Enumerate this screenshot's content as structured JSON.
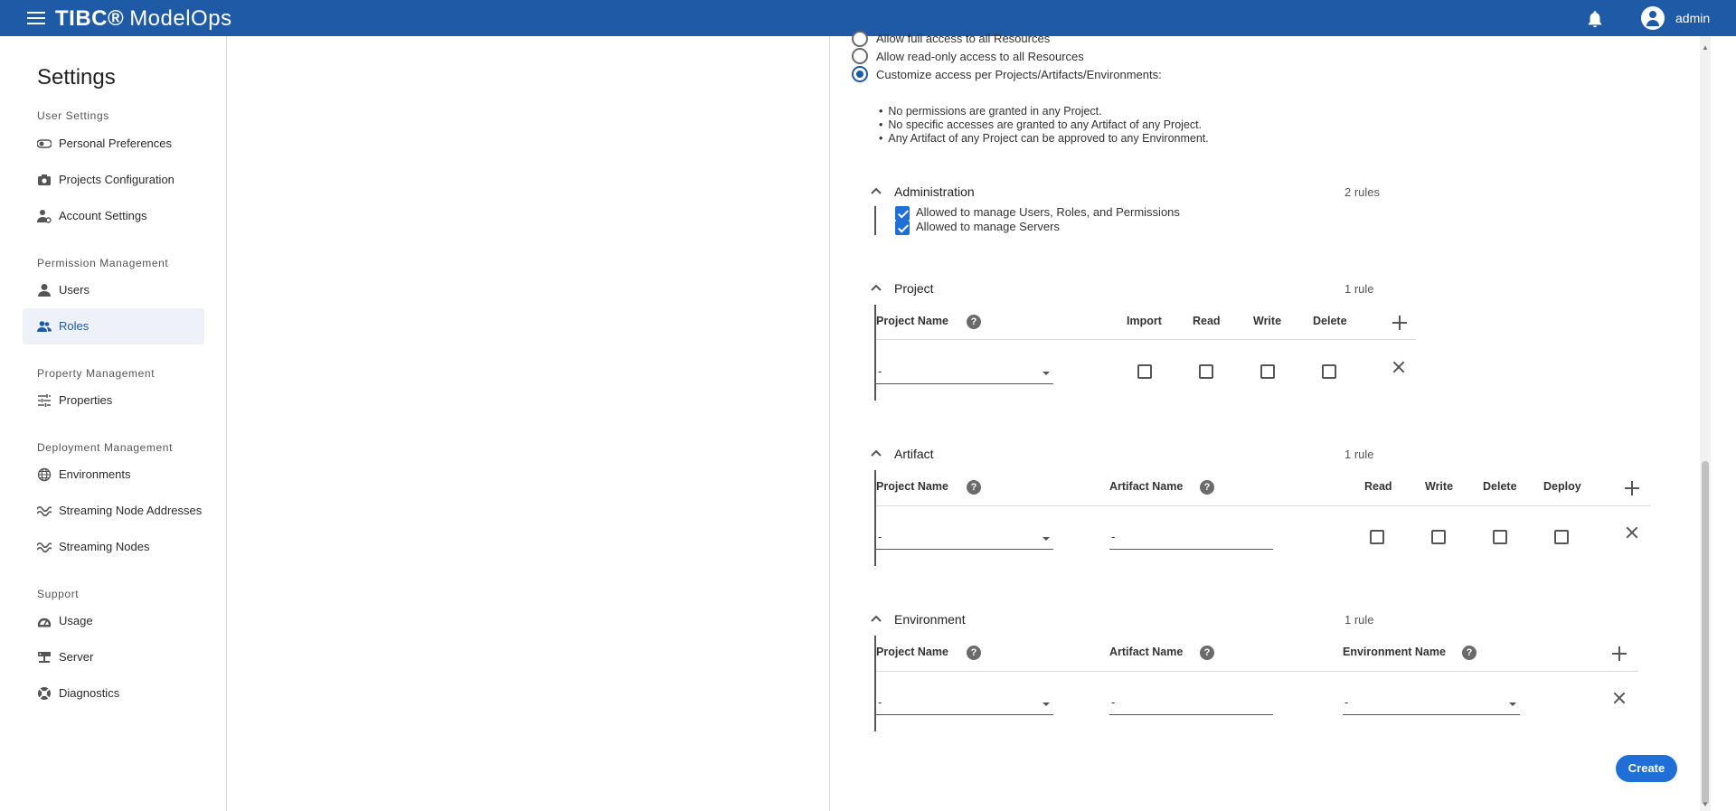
{
  "header": {
    "brand_primary": "TIBC®",
    "brand_secondary": "ModelOps",
    "user": "admin"
  },
  "sidebar": {
    "title": "Settings",
    "sections": [
      {
        "label": "User Settings",
        "items": [
          "Personal Preferences",
          "Projects Configuration",
          "Account Settings"
        ]
      },
      {
        "label": "Permission Management",
        "items": [
          "Users",
          "Roles"
        ]
      },
      {
        "label": "Property Management",
        "items": [
          "Properties"
        ]
      },
      {
        "label": "Deployment Management",
        "items": [
          "Environments",
          "Streaming Node Addresses",
          "Streaming Nodes"
        ]
      },
      {
        "label": "Support",
        "items": [
          "Usage",
          "Server",
          "Diagnostics"
        ]
      }
    ],
    "active_item": "Roles"
  },
  "access": {
    "options": [
      "Allow full access to all Resources",
      "Allow read-only access to all Resources",
      "Customize access per Projects/Artifacts/Environments:"
    ],
    "selected": 2,
    "notes": [
      "No permissions are granted in any Project.",
      "No specific accesses are granted to any Artifact of any Project.",
      "Any Artifact of any Project can be approved to any Environment."
    ]
  },
  "administration": {
    "title": "Administration",
    "count": "2 rules",
    "rules": [
      "Allowed to manage Users, Roles, and Permissions",
      "Allowed to manage Servers"
    ]
  },
  "project": {
    "title": "Project",
    "count": "1 rule",
    "col_name": "Project Name",
    "cols": [
      "Import",
      "Read",
      "Write",
      "Delete"
    ],
    "row": {
      "project": "-"
    }
  },
  "artifact": {
    "title": "Artifact",
    "count": "1 rule",
    "col_project": "Project Name",
    "col_artifact": "Artifact Name",
    "cols": [
      "Read",
      "Write",
      "Delete",
      "Deploy"
    ],
    "row": {
      "project": "-",
      "artifact": "-"
    }
  },
  "environment": {
    "title": "Environment",
    "count": "1 rule",
    "col_project": "Project Name",
    "col_artifact": "Artifact Name",
    "col_env": "Environment Name",
    "row": {
      "project": "-",
      "artifact": "-",
      "environment": "-"
    }
  },
  "actions": {
    "create": "Create"
  },
  "help_glyph": "?"
}
